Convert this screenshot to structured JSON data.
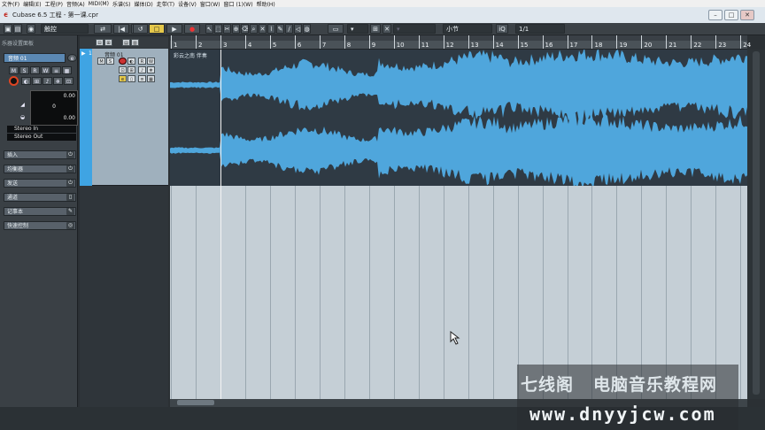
{
  "menu": [
    "文件(F)",
    "编辑(E)",
    "工程(P)",
    "音频(A)",
    "MIDI(M)",
    "乐谱(S)",
    "媒体(D)",
    "走带(T)",
    "设备(V)",
    "窗口(W)",
    "窗口 (1)(W)",
    "帮助(H)"
  ],
  "window": {
    "title": "Cubase 6.5 工程 - 第一课.cpr"
  },
  "toolbar": {
    "automation_mode": "触控",
    "snap_type": "小节",
    "quantize_value": "1/1",
    "iq": "iQ"
  },
  "inspector": {
    "header": "乐器设置面板",
    "track_name": "音频 01",
    "lcd_values": [
      "0.00",
      "0",
      "0.00"
    ],
    "routing": {
      "input": "Stereo In",
      "output": "Stereo Out"
    },
    "sections": [
      "插入",
      "均衡器",
      "发送",
      "通道",
      "记事本",
      "快速控制"
    ]
  },
  "track": {
    "number": "1",
    "name": "音频 01"
  },
  "ruler": {
    "bars": [
      "1",
      "2",
      "3",
      "4",
      "5",
      "6",
      "7",
      "8",
      "9",
      "10",
      "11",
      "12",
      "13",
      "14",
      "15",
      "16",
      "17",
      "18",
      "19",
      "20",
      "21",
      "22",
      "23",
      "24"
    ]
  },
  "event": {
    "name": "彩云之南 伴奏"
  },
  "watermark": {
    "line1_a": "七线阁",
    "line1_b": "电脑音乐教程网",
    "line2": "www.dnyyjcw.com"
  },
  "colors": {
    "waveform": "#4fa6dc",
    "selected_track": "#3fa4e3",
    "record": "#d42"
  }
}
